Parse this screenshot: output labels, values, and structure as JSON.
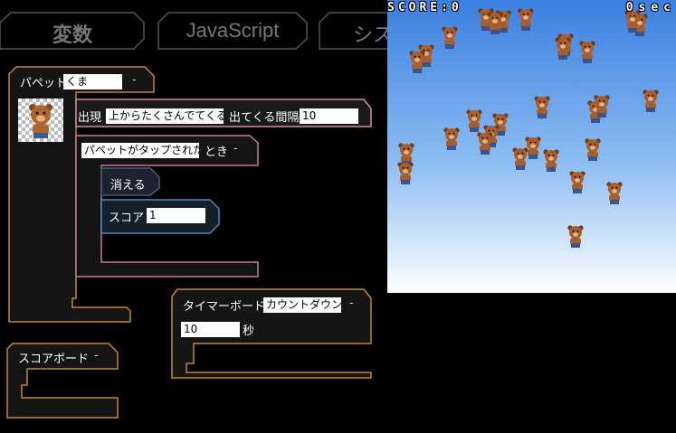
{
  "tabs": [
    {
      "label": "変数"
    },
    {
      "label": "JavaScript"
    },
    {
      "label": "シス"
    }
  ],
  "puppet_block": {
    "label": "パペット",
    "name_value": "くま",
    "menu": "-"
  },
  "appear_block": {
    "label": "出現",
    "mode_value": "上からたくさんでてくる",
    "interval_label": "出てくる間隔",
    "interval_value": "10"
  },
  "tap_block": {
    "event_value": "パペットがタップされた",
    "label": "とき",
    "menu": "-"
  },
  "disappear_block": {
    "label": "消える"
  },
  "score_block": {
    "label": "スコア",
    "value": "1"
  },
  "timer_block": {
    "label": "タイマーボード",
    "mode_value": "カウントダウン",
    "menu": "-",
    "seconds_value": "10",
    "unit": "秒"
  },
  "scoreboard_block": {
    "label": "スコアボード",
    "menu": "-"
  },
  "stage": {
    "score_text": "SCORE:0",
    "time_text": "0sec",
    "bear_count": 30
  },
  "colors": {
    "puppet_border": "#c8862a",
    "appear_border": "#d88aa0",
    "tap_border": "#c87a8e",
    "disappear_border": "#4a5a7a",
    "score_border": "#4a8ab8",
    "timer_border": "#c8862a",
    "tab_border": "#555555"
  }
}
